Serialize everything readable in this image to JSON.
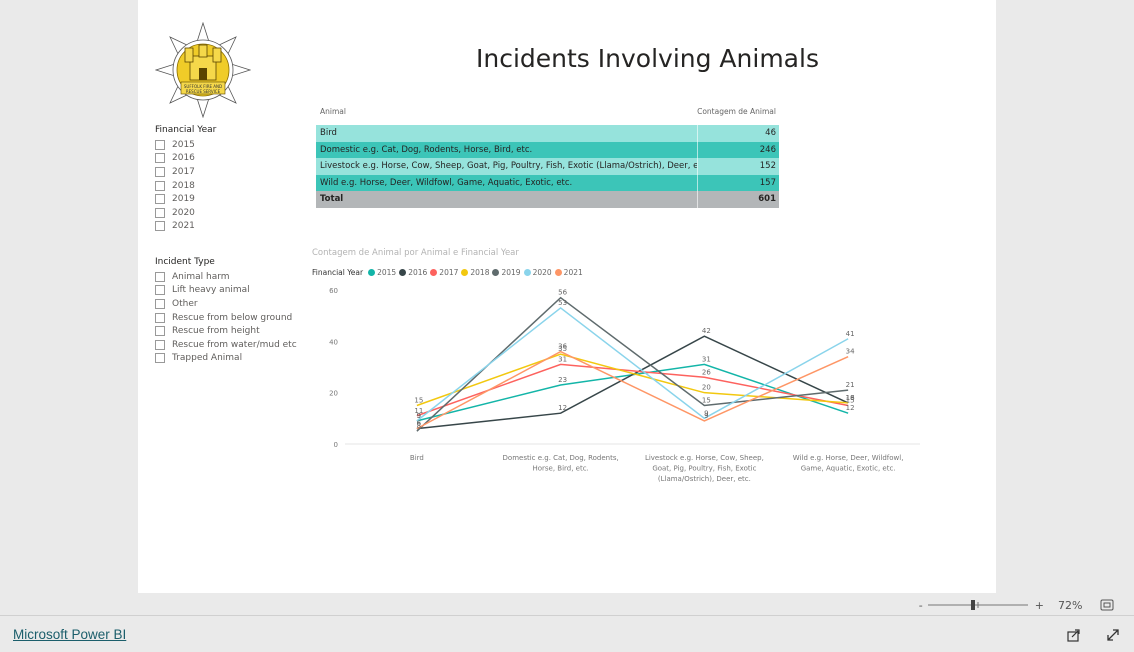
{
  "report": {
    "title": "Incidents Involving Animals",
    "logo_text_top": "SUFFOLK FIRE AND",
    "logo_text_bottom": "RESCUE SERVICE"
  },
  "slicers": {
    "financial_year": {
      "title": "Financial Year",
      "items": [
        "2015",
        "2016",
        "2017",
        "2018",
        "2019",
        "2020",
        "2021"
      ]
    },
    "incident_type": {
      "title": "Incident Type",
      "items": [
        "Animal harm",
        "Lift heavy animal",
        "Other",
        "Rescue from below ground",
        "Rescue from height",
        "Rescue from water/mud etc",
        "Trapped Animal"
      ]
    }
  },
  "table": {
    "col_animal": "Animal",
    "col_count": "Contagem de Animal",
    "rows": [
      {
        "animal": "Bird",
        "count": "46",
        "bg": "#96e3dc"
      },
      {
        "animal": "Domestic e.g. Cat, Dog, Rodents, Horse, Bird, etc.",
        "count": "246",
        "bg": "#3cc5b8"
      },
      {
        "animal": "Livestock e.g. Horse, Cow, Sheep, Goat, Pig, Poultry, Fish, Exotic (Llama/Ostrich), Deer, etc.",
        "count": "152",
        "bg": "#96e3dc"
      },
      {
        "animal": "Wild e.g. Horse, Deer, Wildfowl, Game, Aquatic, Exotic, etc.",
        "count": "157",
        "bg": "#3cc5b8"
      }
    ],
    "total_label": "Total",
    "total_value": "601"
  },
  "chart_data": {
    "type": "line",
    "title": "Contagem de Animal por Animal e Financial Year",
    "legend_title": "Financial Year",
    "legend_position": "top-left",
    "categories": [
      "Bird",
      "Domestic e.g. Cat, Dog, Rodents, Horse, Bird, etc.",
      "Livestock e.g. Horse, Cow, Sheep, Goat, Pig, Poultry, Fish, Exotic (Llama/Ostrich), Deer, etc.",
      "Wild e.g. Horse, Deer, Wildfowl, Game, Aquatic, Exotic, etc."
    ],
    "category_lines": [
      [
        "Bird"
      ],
      [
        "Domestic e.g. Cat, Dog, Rodents,",
        "Horse, Bird, etc."
      ],
      [
        "Livestock e.g. Horse, Cow, Sheep,",
        "Goat, Pig, Poultry, Fish, Exotic",
        "(Llama/Ostrich), Deer, etc."
      ],
      [
        "Wild e.g. Horse, Deer, Wildfowl,",
        "Game, Aquatic, Exotic, etc."
      ]
    ],
    "ylim": [
      0,
      60
    ],
    "yticks": [
      0,
      20,
      40,
      60
    ],
    "grid": false,
    "series": [
      {
        "name": "2015",
        "color": "#13b5a8",
        "values": [
          9,
          23,
          31,
          12
        ]
      },
      {
        "name": "2016",
        "color": "#374649",
        "values": [
          6,
          12,
          42,
          16
        ]
      },
      {
        "name": "2017",
        "color": "#fd625e",
        "values": [
          11,
          31,
          26,
          15
        ]
      },
      {
        "name": "2018",
        "color": "#f2c80f",
        "values": [
          15,
          35,
          20,
          16
        ]
      },
      {
        "name": "2019",
        "color": "#5f6b6d",
        "values": [
          5,
          57,
          15,
          21
        ]
      },
      {
        "name": "2020",
        "color": "#8ad4eb",
        "values": [
          9,
          53,
          10,
          41
        ]
      },
      {
        "name": "2021",
        "color": "#fe9666",
        "values": [
          6,
          36,
          9,
          34
        ]
      }
    ],
    "data_labels": [
      [
        "9",
        "23",
        "31",
        "12"
      ],
      [
        "6",
        "12",
        "42",
        "16"
      ],
      [
        "11",
        "31",
        "26",
        "15"
      ],
      [
        "15",
        "35",
        "20",
        "18"
      ],
      [
        "8",
        "56",
        "15",
        "21"
      ],
      [
        "9",
        "53",
        "9",
        "41"
      ],
      [
        "6",
        "36",
        "9",
        "34"
      ]
    ]
  },
  "footer": {
    "zoom_level": "72%",
    "zoom_minus": "-",
    "zoom_plus": "+",
    "zoom_fraction": 0.45,
    "brand": "Microsoft Power BI"
  }
}
